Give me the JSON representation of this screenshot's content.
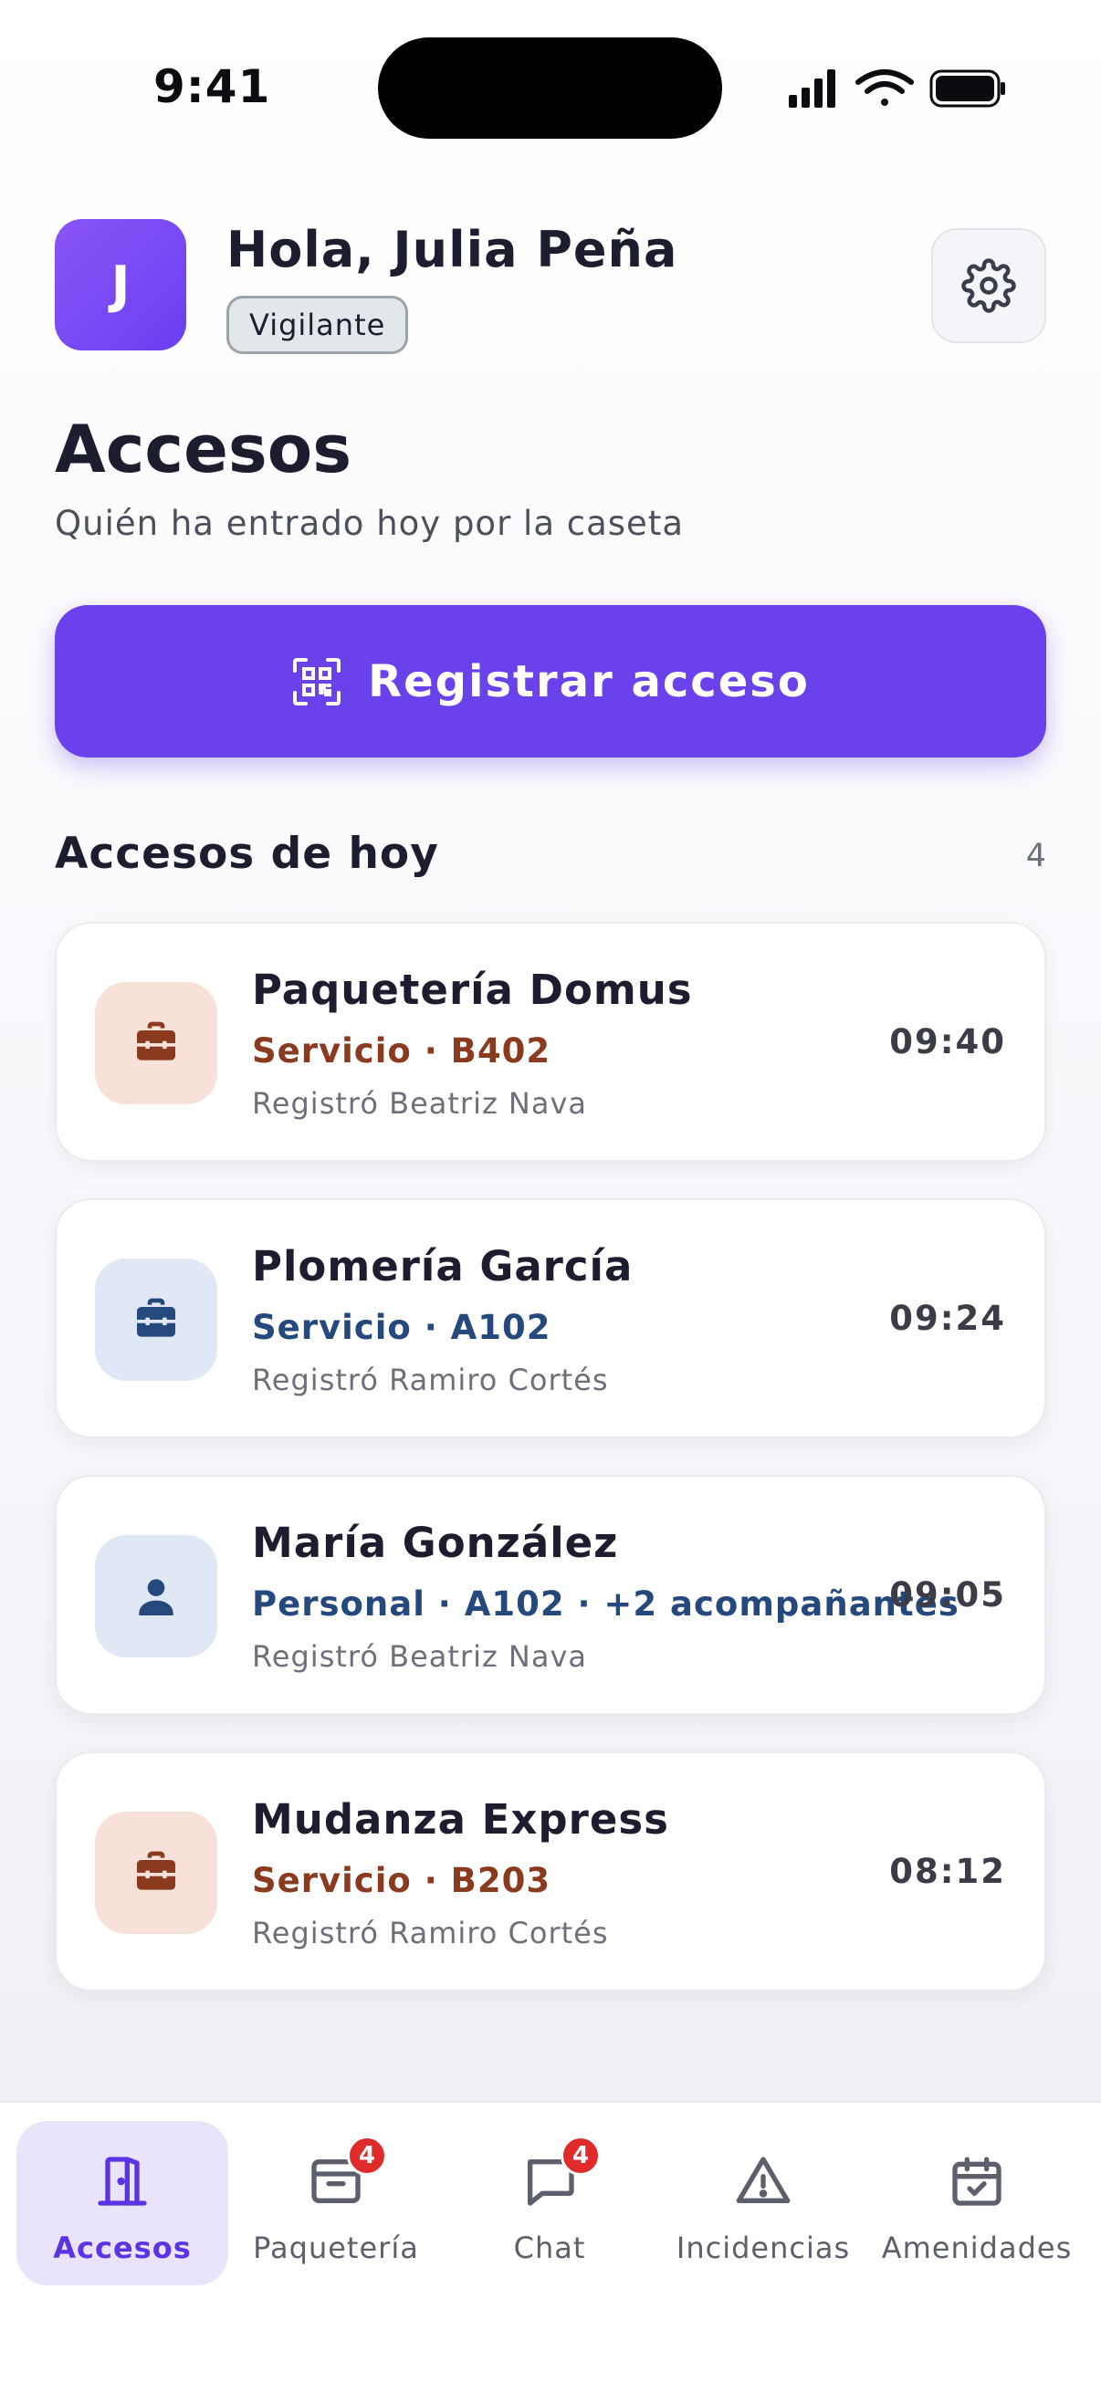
{
  "status_bar": {
    "time": "9:41"
  },
  "header": {
    "avatar_initial": "J",
    "greeting": "Hola, Julia Peña",
    "role": "Vigilante"
  },
  "page": {
    "title": "Accesos",
    "subtitle": "Quién ha entrado hoy por la caseta"
  },
  "register_button": {
    "label": "Registrar acceso",
    "icon": "qr-scan-icon"
  },
  "section": {
    "title": "Accesos de hoy",
    "count": "4"
  },
  "accesses": [
    {
      "name": "Paquetería Domus",
      "detail": "Servicio · B402",
      "registered_by": "Registró Beatriz Nava",
      "time": "09:40",
      "icon": "briefcase-icon",
      "color": "#8a3a1e"
    },
    {
      "name": "Plomería García",
      "detail": "Servicio · A102",
      "registered_by": "Registró Ramiro Cortés",
      "time": "09:24",
      "icon": "briefcase-icon",
      "color": "#25497d"
    },
    {
      "name": "María González",
      "detail": "Personal · A102 · +2 acompañantes",
      "registered_by": "Registró Beatriz Nava",
      "time": "09:05",
      "icon": "person-icon",
      "color": "#25497d"
    },
    {
      "name": "Mudanza Express",
      "detail": "Servicio · B203",
      "registered_by": "Registró Ramiro Cortés",
      "time": "08:12",
      "icon": "briefcase-icon",
      "color": "#8a3a1e"
    }
  ],
  "tabs": [
    {
      "label": "Accesos",
      "icon": "door-icon",
      "active": true
    },
    {
      "label": "Paquetería",
      "icon": "package-icon",
      "badge": "4"
    },
    {
      "label": "Chat",
      "icon": "chat-icon",
      "badge": "4"
    },
    {
      "label": "Incidencias",
      "icon": "warning-icon"
    },
    {
      "label": "Amenidades",
      "icon": "calendar-icon"
    }
  ],
  "colors": {
    "accent": "#6a42ec",
    "badge": "#e02b2b"
  }
}
